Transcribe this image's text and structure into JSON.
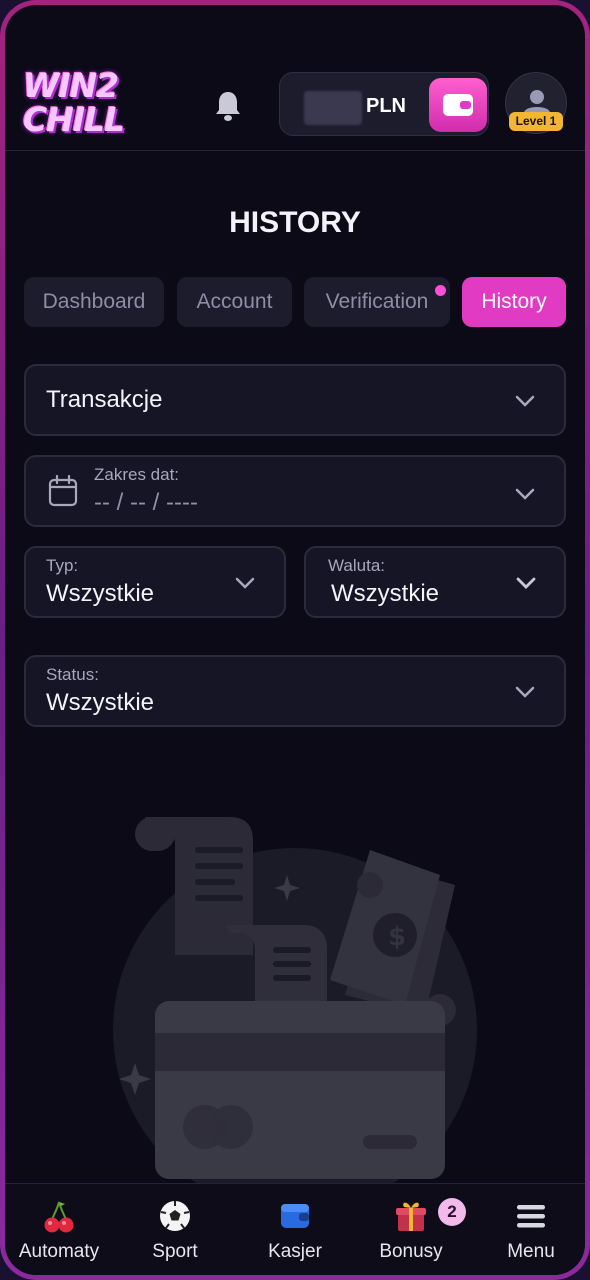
{
  "header": {
    "logo_line1": "WIN2",
    "logo_line2": "CHILL",
    "currency": "PLN",
    "level": "Level 1",
    "icons": [
      "bell-icon",
      "wallet-icon",
      "user-icon"
    ]
  },
  "page": {
    "title": "HISTORY"
  },
  "tabs": [
    {
      "label": "Dashboard",
      "active": false
    },
    {
      "label": "Account",
      "active": false
    },
    {
      "label": "Verification",
      "active": false,
      "dot": true
    },
    {
      "label": "History",
      "active": true
    }
  ],
  "filters": {
    "category": {
      "value": "Transakcje"
    },
    "date": {
      "label": "Zakres dat:",
      "placeholder": "-- / -- / ----"
    },
    "type": {
      "label": "Typ:",
      "value": "Wszystkie"
    },
    "currency": {
      "label": "Waluta:",
      "value": "Wszystkie"
    },
    "status": {
      "label": "Status:",
      "value": "Wszystkie"
    }
  },
  "bottom_nav": [
    {
      "label": "Automaty",
      "icon": "cherries-icon"
    },
    {
      "label": "Sport",
      "icon": "soccer-ball-icon"
    },
    {
      "label": "Kasjer",
      "icon": "wallet-icon"
    },
    {
      "label": "Bonusy",
      "icon": "gift-icon",
      "badge": "2"
    },
    {
      "label": "Menu",
      "icon": "menu-icon"
    }
  ],
  "colors": {
    "accent": "#e23bc3",
    "background": "#0b0a16",
    "level_badge": "#f2b632"
  }
}
